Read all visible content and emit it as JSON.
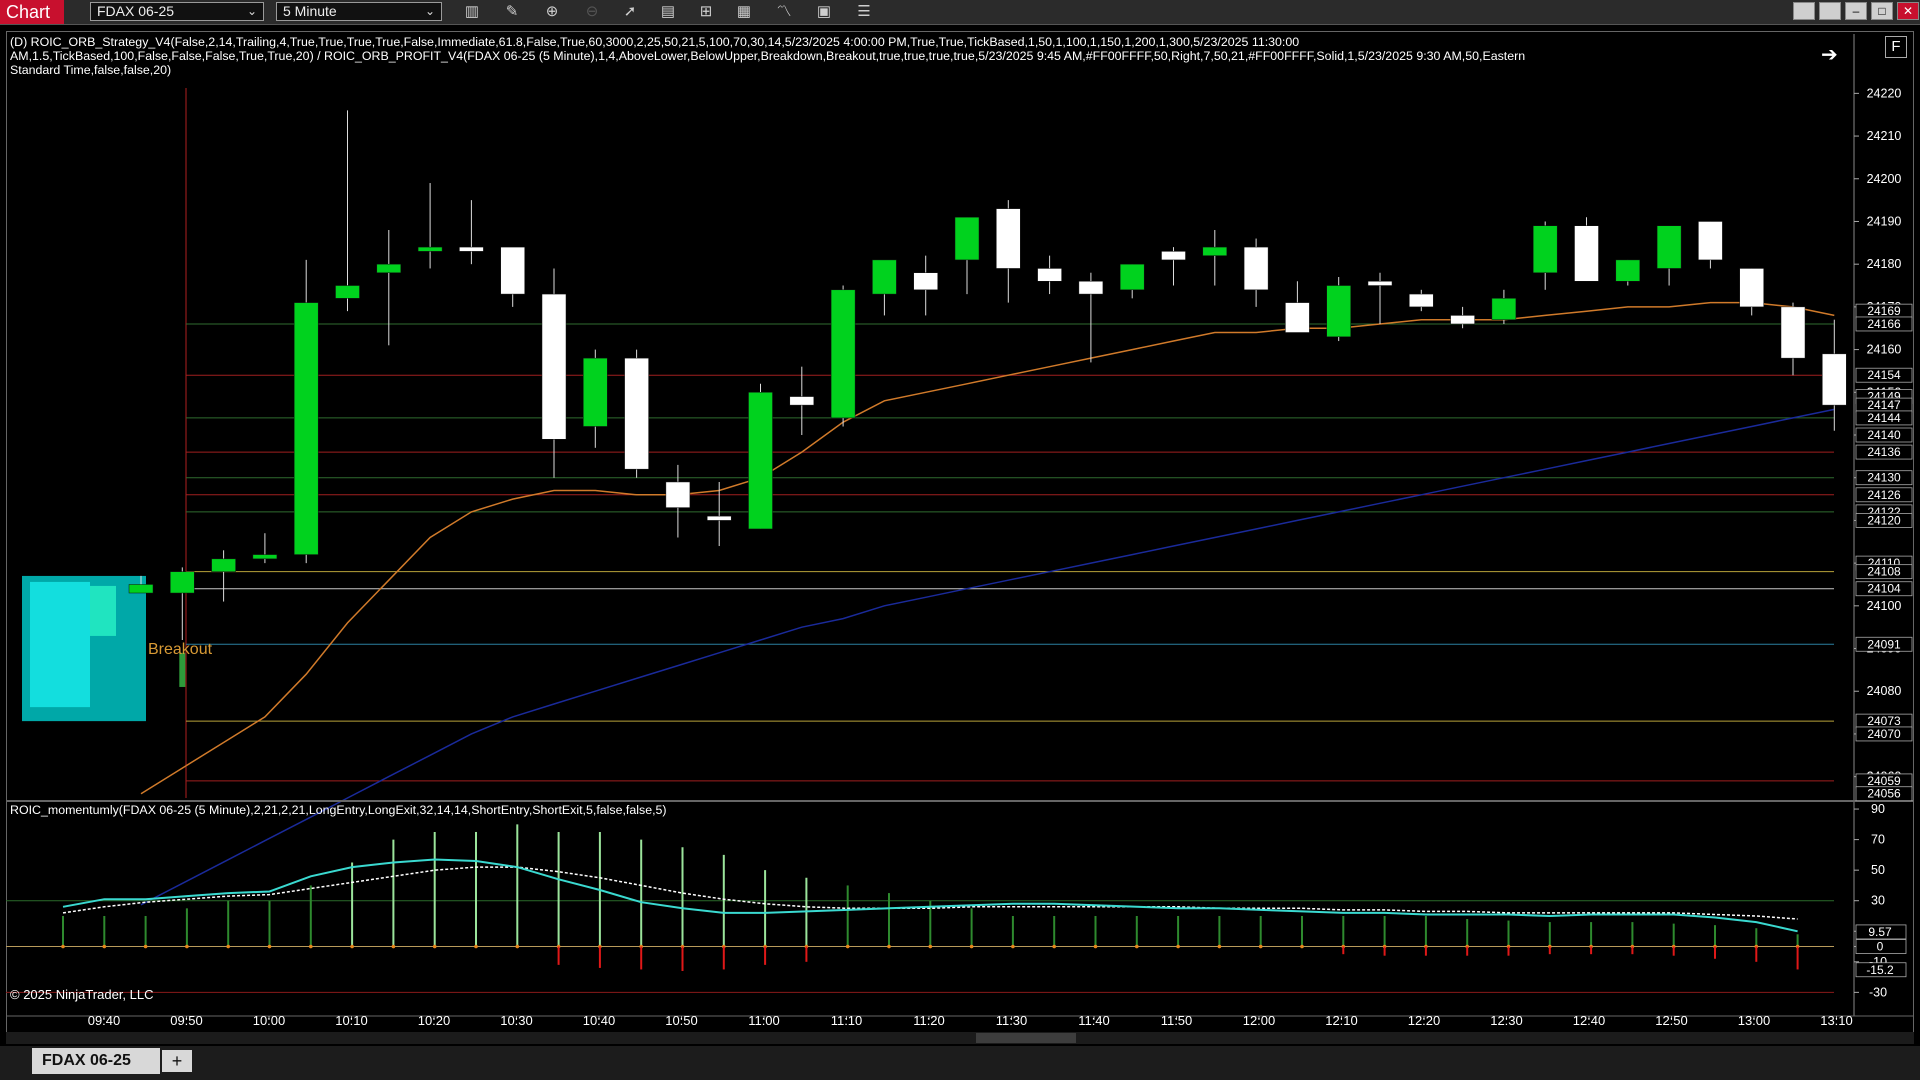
{
  "app_label": "Chart",
  "toolbar": {
    "instrument": "FDAX 06-25",
    "interval": "5 Minute",
    "icons": [
      "bar-type-icon",
      "pencil-icon",
      "zoom-in-icon",
      "zoom-out-icon",
      "pointer-icon",
      "data-box-icon",
      "properties-icon",
      "strategy-icon",
      "indicator-icon",
      "template-icon",
      "menu-icon"
    ]
  },
  "panel1": {
    "label_lines": [
      "(D) ROIC_ORB_Strategy_V4(False,2,14,Trailing,4,True,True,True,True,False,Immediate,61.8,False,True,60,3000,2,25,50,21,5,100,70,30,14,5/23/2025 4:00:00 PM,True,True,TickBased,1,50,1,100,1,150,1,200,1,300,5/23/2025 11:30:00",
      "AM,1.5,TickBased,100,False,False,False,True,True,20) / ROIC_ORB_PROFIT_V4(FDAX 06-25 (5 Minute),1,4,AboveLower,BelowUpper,Breakdown,Breakout,true,true,true,true,5/23/2025 9:45 AM,#FF00FFFF,50,Right,7,50,21,#FF00FFFF,Solid,1,5/23/2025 9:30 AM,50,Eastern",
      "Standard Time,false,false,20)"
    ],
    "breakout_label": "Breakout"
  },
  "panel2": {
    "label": "ROIC_momentumly(FDAX 06-25 (5 Minute),2,21,2,21,LongEntry,LongExit,32,14,14,ShortEntry,ShortExit,5,false,false,5)"
  },
  "copyright": "© 2025 NinjaTrader, LLC",
  "float_button": "F",
  "tab": {
    "name": "FDAX 06-25",
    "add": "+"
  },
  "colors": {
    "up": "#00d21e",
    "down": "#ffffff",
    "ema_fast": "#d07a2a",
    "ema_slow": "#1a2a9a",
    "momentum": "#3ad9d0",
    "signal": "#ffffff"
  },
  "chart_data": [
    {
      "type": "candlestick",
      "y_ticks": [
        24220,
        24210,
        24200,
        24190,
        24180,
        24170,
        24160,
        24150,
        24140,
        24130,
        24120,
        24110,
        24100,
        24090,
        24080,
        24070,
        24060
      ],
      "y_marker_labels": [
        24169,
        24166,
        24154,
        24149,
        24147,
        24144,
        24140,
        24136,
        24130,
        24126,
        24122,
        24120,
        24110,
        24108,
        24104,
        24091,
        24073,
        24070,
        24059,
        24056
      ],
      "x_ticks": [
        "09:40",
        "09:50",
        "10:00",
        "10:10",
        "10:20",
        "10:30",
        "10:40",
        "10:50",
        "11:00",
        "11:10",
        "11:20",
        "11:30",
        "11:40",
        "11:50",
        "12:00",
        "12:10",
        "12:20",
        "12:30",
        "12:40",
        "12:50",
        "13:00",
        "13:10"
      ],
      "ylim": [
        24055,
        24225
      ],
      "orb_box": {
        "high": 24107,
        "low": 24073
      },
      "candles": [
        {
          "o": 24103,
          "h": 24107,
          "l": 24103,
          "c": 24105
        },
        {
          "o": 24103,
          "h": 24109,
          "l": 24092,
          "c": 24108
        },
        {
          "o": 24108,
          "h": 24113,
          "l": 24101,
          "c": 24111
        },
        {
          "o": 24111,
          "h": 24117,
          "l": 24110,
          "c": 24112
        },
        {
          "o": 24112,
          "h": 24181,
          "l": 24110,
          "c": 24171
        },
        {
          "o": 24172,
          "h": 24216,
          "l": 24169,
          "c": 24175
        },
        {
          "o": 24178,
          "h": 24188,
          "l": 24161,
          "c": 24180
        },
        {
          "o": 24183,
          "h": 24199,
          "l": 24179,
          "c": 24184
        },
        {
          "o": 24184,
          "h": 24195,
          "l": 24180,
          "c": 24183
        },
        {
          "o": 24184,
          "h": 24183,
          "l": 24170,
          "c": 24173
        },
        {
          "o": 24173,
          "h": 24179,
          "l": 24130,
          "c": 24139
        },
        {
          "o": 24142,
          "h": 24160,
          "l": 24137,
          "c": 24158
        },
        {
          "o": 24158,
          "h": 24160,
          "l": 24130,
          "c": 24132
        },
        {
          "o": 24129,
          "h": 24133,
          "l": 24116,
          "c": 24123
        },
        {
          "o": 24121,
          "h": 24129,
          "l": 24114,
          "c": 24120
        },
        {
          "o": 24118,
          "h": 24152,
          "l": 24118,
          "c": 24150
        },
        {
          "o": 24149,
          "h": 24156,
          "l": 24140,
          "c": 24147
        },
        {
          "o": 24144,
          "h": 24175,
          "l": 24142,
          "c": 24174
        },
        {
          "o": 24173,
          "h": 24180,
          "l": 24168,
          "c": 24181
        },
        {
          "o": 24178,
          "h": 24182,
          "l": 24168,
          "c": 24174
        },
        {
          "o": 24181,
          "h": 24191,
          "l": 24173,
          "c": 24191
        },
        {
          "o": 24193,
          "h": 24195,
          "l": 24171,
          "c": 24179
        },
        {
          "o": 24179,
          "h": 24182,
          "l": 24173,
          "c": 24176
        },
        {
          "o": 24176,
          "h": 24178,
          "l": 24157,
          "c": 24173
        },
        {
          "o": 24174,
          "h": 24180,
          "l": 24172,
          "c": 24180
        },
        {
          "o": 24183,
          "h": 24184,
          "l": 24175,
          "c": 24181
        },
        {
          "o": 24182,
          "h": 24188,
          "l": 24175,
          "c": 24184
        },
        {
          "o": 24184,
          "h": 24186,
          "l": 24170,
          "c": 24174
        },
        {
          "o": 24171,
          "h": 24176,
          "l": 24164,
          "c": 24164
        },
        {
          "o": 24163,
          "h": 24177,
          "l": 24162,
          "c": 24175
        },
        {
          "o": 24176,
          "h": 24178,
          "l": 24166,
          "c": 24175
        },
        {
          "o": 24173,
          "h": 24174,
          "l": 24169,
          "c": 24170
        },
        {
          "o": 24168,
          "h": 24170,
          "l": 24165,
          "c": 24166
        },
        {
          "o": 24167,
          "h": 24174,
          "l": 24166,
          "c": 24172
        },
        {
          "o": 24178,
          "h": 24190,
          "l": 24174,
          "c": 24189
        },
        {
          "o": 24189,
          "h": 24191,
          "l": 24176,
          "c": 24176
        },
        {
          "o": 24176,
          "h": 24181,
          "l": 24175,
          "c": 24181
        },
        {
          "o": 24179,
          "h": 24189,
          "l": 24175,
          "c": 24189
        },
        {
          "o": 24190,
          "h": 24190,
          "l": 24179,
          "c": 24181
        },
        {
          "o": 24179,
          "h": 24179,
          "l": 24168,
          "c": 24170
        },
        {
          "o": 24170,
          "h": 24171,
          "l": 24154,
          "c": 24158
        },
        {
          "o": 24159,
          "h": 24167,
          "l": 24141,
          "c": 24147
        }
      ],
      "horizontal_levels": [
        {
          "y": 24166,
          "color": "#2f6b2f"
        },
        {
          "y": 24154,
          "color": "#a01f1f"
        },
        {
          "y": 24144,
          "color": "#2f6b2f"
        },
        {
          "y": 24136,
          "color": "#a01f1f"
        },
        {
          "y": 24130,
          "color": "#2f6b2f"
        },
        {
          "y": 24126,
          "color": "#a01f1f"
        },
        {
          "y": 24122,
          "color": "#2f6b2f"
        },
        {
          "y": 24108,
          "color": "#b8a23a"
        },
        {
          "y": 24104,
          "color": "#c8c8c8"
        },
        {
          "y": 24091,
          "color": "#2a7f9f"
        },
        {
          "y": 24073,
          "color": "#b8a23a"
        },
        {
          "y": 24059,
          "color": "#a01f1f"
        }
      ],
      "ema_fast": [
        24056,
        24062,
        24068,
        24074,
        24084,
        24096,
        24106,
        24116,
        24122,
        24125,
        24127,
        24127,
        24126,
        24126,
        24127,
        24130,
        24136,
        24143,
        24148,
        24150,
        24152,
        24154,
        24156,
        24158,
        24160,
        24162,
        24164,
        24164,
        24165,
        24165,
        24166,
        24167,
        24167,
        24167,
        24168,
        24169,
        24170,
        24170,
        24171,
        24171,
        24170,
        24168
      ],
      "ema_slow": [
        24030,
        24035,
        24040,
        24045,
        24050,
        24055,
        24060,
        24065,
        24070,
        24074,
        24077,
        24080,
        24083,
        24086,
        24089,
        24092,
        24095,
        24097,
        24100,
        24102,
        24104,
        24106,
        24108,
        24110,
        24112,
        24114,
        24116,
        24118,
        24120,
        24122,
        24124,
        24126,
        24128,
        24130,
        24132,
        24134,
        24136,
        24138,
        24140,
        24142,
        24144,
        24146
      ]
    },
    {
      "type": "line",
      "y_ticks": [
        90,
        70,
        50,
        30,
        10,
        0,
        -10,
        -30
      ],
      "y_marker_labels": [
        9.57,
        0,
        -15.2
      ],
      "ylim": [
        -35,
        92
      ],
      "momentum": [
        26,
        31,
        31,
        33,
        35,
        36,
        46,
        52,
        55,
        57,
        56,
        52,
        44,
        37,
        29,
        25,
        22,
        22,
        23,
        24,
        25,
        26,
        27,
        28,
        28,
        27,
        26,
        25,
        25,
        24,
        23,
        22,
        22,
        21,
        21,
        21,
        20,
        21,
        21,
        21,
        19,
        16,
        10
      ],
      "signal": [
        22,
        26,
        29,
        31,
        33,
        34,
        38,
        42,
        46,
        50,
        52,
        52,
        49,
        45,
        40,
        35,
        31,
        28,
        26,
        25,
        25,
        25,
        26,
        26,
        26,
        26,
        26,
        26,
        25,
        25,
        25,
        24,
        24,
        23,
        23,
        22,
        22,
        22,
        22,
        22,
        21,
        20,
        18
      ],
      "histogram": [
        20,
        20,
        20,
        25,
        30,
        30,
        40,
        55,
        70,
        75,
        75,
        80,
        75,
        75,
        70,
        65,
        60,
        50,
        45,
        40,
        35,
        30,
        25,
        20,
        20,
        20,
        20,
        20,
        20,
        20,
        20,
        20,
        20,
        20,
        18,
        17,
        16,
        16,
        16,
        15,
        14,
        12,
        8
      ],
      "neg_histogram": [
        0,
        0,
        0,
        0,
        0,
        0,
        0,
        0,
        0,
        0,
        0,
        0,
        -12,
        -14,
        -15,
        -16,
        -15,
        -12,
        -10,
        0,
        0,
        0,
        0,
        0,
        0,
        0,
        0,
        0,
        0,
        0,
        0,
        -5,
        -6,
        -6,
        -6,
        -6,
        -5,
        -5,
        -5,
        -6,
        -8,
        -10,
        -15
      ]
    }
  ]
}
